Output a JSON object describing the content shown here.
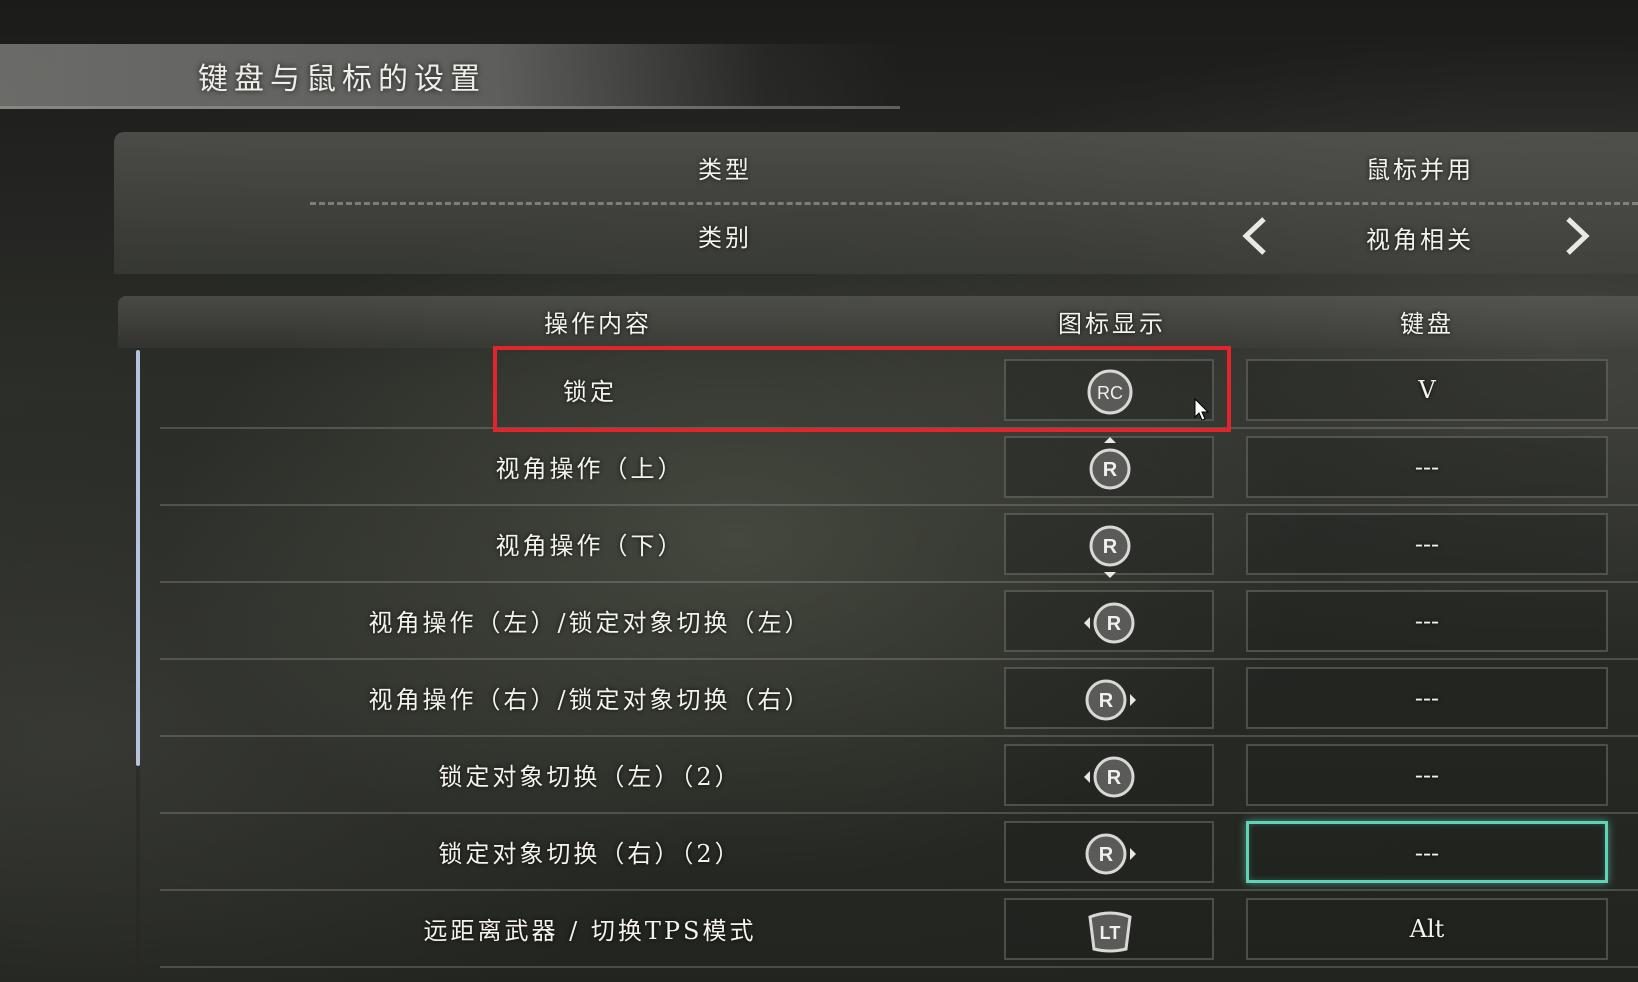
{
  "page_title": "键盘与鼠标的设置",
  "settings": {
    "type_label": "类型",
    "type_value": "鼠标并用",
    "category_label": "类别",
    "category_value": "视角相关"
  },
  "table": {
    "headers": {
      "action": "操作内容",
      "icon": "图标显示",
      "keyboard": "键盘"
    },
    "rows": [
      {
        "action": "锁定",
        "icon": "RC",
        "key": "V"
      },
      {
        "action": "视角操作（上）",
        "icon": "R",
        "key": "---"
      },
      {
        "action": "视角操作（下）",
        "icon": "R",
        "key": "---"
      },
      {
        "action": "视角操作（左）/锁定对象切换（左）",
        "icon": "R",
        "key": "---"
      },
      {
        "action": "视角操作（右）/锁定对象切换（右）",
        "icon": "R",
        "key": "---"
      },
      {
        "action": "锁定对象切换（左）（2）",
        "icon": "R",
        "key": "---"
      },
      {
        "action": "锁定对象切换（右）（2）",
        "icon": "R",
        "key": "---"
      },
      {
        "action": "远距离武器 / 切换TPS模式",
        "icon": "LT",
        "key": "Alt"
      }
    ]
  },
  "icons": {
    "prev": "chevron-left-icon",
    "next": "chevron-right-icon",
    "cursor": "mouse-cursor-icon"
  },
  "colors": {
    "highlight": "#e0262c",
    "active_cell": "#5fd3b6",
    "scrollbar": "#b9c2dc"
  }
}
